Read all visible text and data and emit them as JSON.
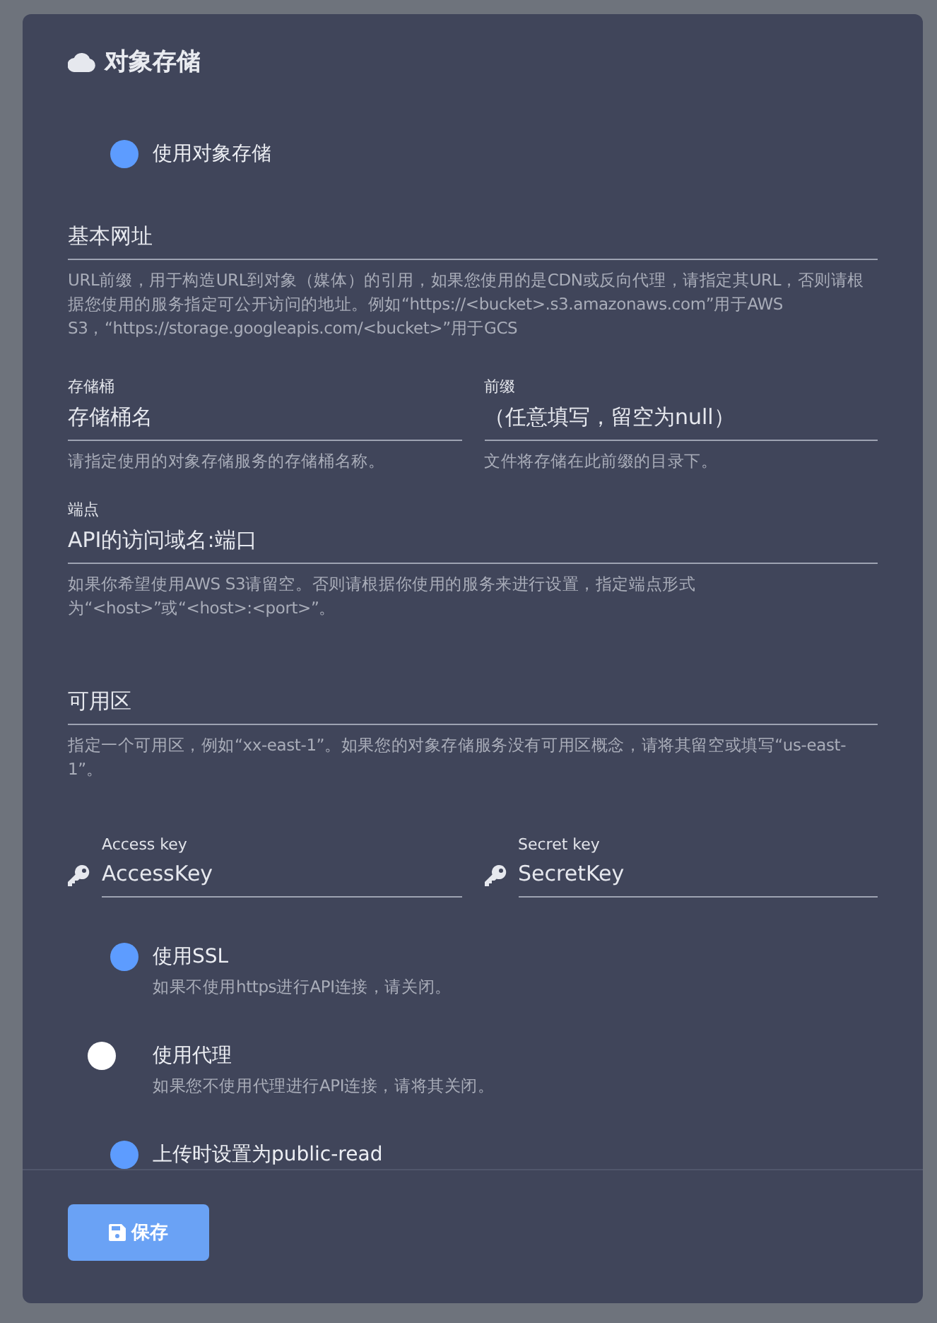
{
  "card": {
    "title": "对象存储"
  },
  "enable_switch": {
    "label": "使用对象存储",
    "on": true
  },
  "base_url": {
    "placeholder": "基本网址",
    "help": "URL前缀，用于构造URL到对象（媒体）的引用，如果您使用的是CDN或反向代理，请指定其URL，否则请根据您使用的服务指定可公开访问的地址。例如“https://<bucket>.s3.amazonaws.com”用于AWS S3，“https://storage.googleapis.com/<bucket>”用于GCS"
  },
  "bucket_row": [
    {
      "label": "存储桶",
      "placeholder": "存储桶名",
      "help": "请指定使用的对象存储服务的存储桶名称。"
    },
    {
      "label": "前缀",
      "placeholder": "（任意填写，留空为null）",
      "help": "文件将存储在此前缀的目录下。"
    }
  ],
  "endpoint": {
    "label": "端点",
    "placeholder": "API的访问域名:端口",
    "help": "如果你希望使用AWS S3请留空。否则请根据你使用的服务来进行设置，指定端点形式为“<host>”或“<host>:<port>”。"
  },
  "region": {
    "placeholder": "可用区",
    "help": "指定一个可用区，例如“xx-east-1”。如果您的对象存储服务没有可用区概念，请将其留空或填写“us-east-1”。"
  },
  "key_row": [
    {
      "label": "Access key",
      "placeholder": "AccessKey"
    },
    {
      "label": "Secret key",
      "placeholder": "SecretKey"
    }
  ],
  "switches": [
    {
      "label": "使用SSL",
      "help": "如果不使用https进行API连接，请关闭。",
      "on": true
    },
    {
      "label": "使用代理",
      "help": "如果您不使用代理进行API连接，请将其关闭。",
      "on": false
    },
    {
      "label": "上传时设置为public-read",
      "on": true
    }
  ],
  "save_button": {
    "label": "保存"
  }
}
